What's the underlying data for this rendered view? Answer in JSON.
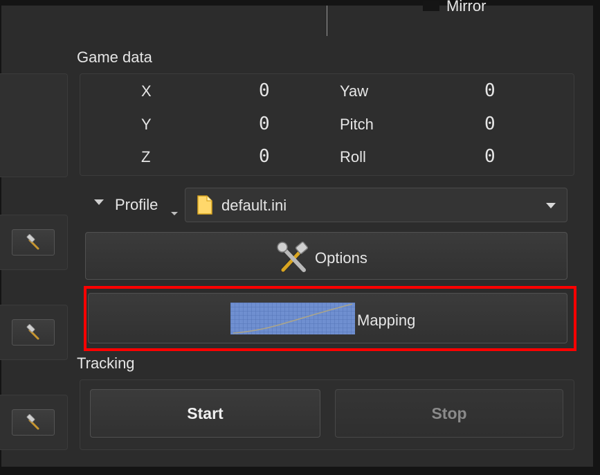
{
  "header": {
    "mirror_label": "Mirror"
  },
  "game_data": {
    "title": "Game data",
    "rows": [
      {
        "axis": "X",
        "axis_value": "0",
        "rot": "Yaw",
        "rot_value": "0"
      },
      {
        "axis": "Y",
        "axis_value": "0",
        "rot": "Pitch",
        "rot_value": "0"
      },
      {
        "axis": "Z",
        "axis_value": "0",
        "rot": "Roll",
        "rot_value": "0"
      }
    ]
  },
  "profile": {
    "label": "Profile",
    "file": "default.ini"
  },
  "options": {
    "label": "Options"
  },
  "mapping": {
    "label": "Mapping",
    "highlighted": true,
    "highlight_color": "#ff0000"
  },
  "tracking": {
    "title": "Tracking",
    "start_label": "Start",
    "stop_label": "Stop",
    "stop_enabled": false
  },
  "colors": {
    "background": "#2c2c2c",
    "text": "#e6e6e6",
    "disabled_text": "#8a8a8a",
    "mapping_graph": "#6f8fd0"
  }
}
